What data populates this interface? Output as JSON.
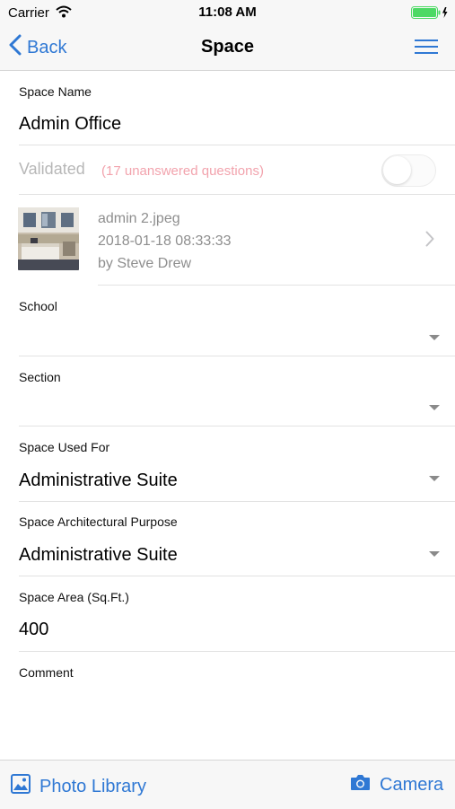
{
  "status_bar": {
    "carrier": "Carrier",
    "time": "11:08 AM",
    "battery_color": "#4cd964"
  },
  "nav": {
    "back_label": "Back",
    "title": "Space",
    "menu_icon": "hamburger-menu-icon",
    "accent_color": "#2f78d4"
  },
  "form": {
    "space_name": {
      "label": "Space Name",
      "value": "Admin Office"
    },
    "validated": {
      "label": "Validated",
      "note": "(17 unanswered questions)",
      "on": false
    },
    "photo": {
      "filename": "admin 2.jpeg",
      "datetime": "2018-01-18 08:33:33",
      "author": "by Steve Drew"
    },
    "school": {
      "label": "School",
      "value": ""
    },
    "section": {
      "label": "Section",
      "value": ""
    },
    "space_used_for": {
      "label": "Space Used For",
      "value": "Administrative Suite"
    },
    "architectural_purpose": {
      "label": "Space Architectural Purpose",
      "value": "Administrative Suite"
    },
    "area": {
      "label": "Space Area (Sq.Ft.)",
      "value": "400"
    },
    "comment": {
      "label": "Comment",
      "value": ""
    }
  },
  "toolbar": {
    "photo_library_label": "Photo Library",
    "camera_label": "Camera"
  }
}
